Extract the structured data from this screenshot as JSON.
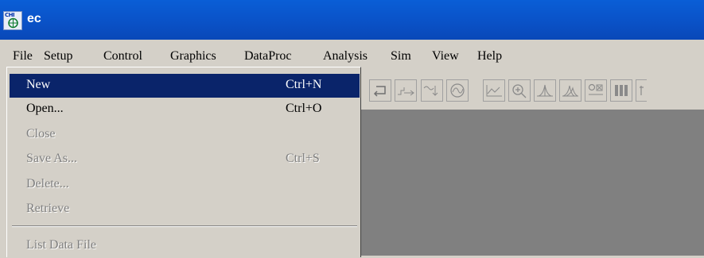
{
  "window": {
    "title": "ec",
    "icon_text": "CHI"
  },
  "menubar": [
    "File",
    "Setup",
    "Control",
    "Graphics",
    "DataProc",
    "Analysis",
    "Sim",
    "View",
    "Help"
  ],
  "file_menu": {
    "items": [
      {
        "label": "New",
        "shortcut": "Ctrl+N",
        "state": "selected"
      },
      {
        "label": "Open...",
        "shortcut": "Ctrl+O",
        "state": "enabled"
      },
      {
        "label": "Close",
        "shortcut": "",
        "state": "disabled"
      },
      {
        "label": "Save As...",
        "shortcut": "Ctrl+S",
        "state": "disabled"
      },
      {
        "label": "Delete...",
        "shortcut": "",
        "state": "disabled"
      },
      {
        "label": "Retrieve",
        "shortcut": "",
        "state": "disabled"
      },
      {
        "label": "List Data File",
        "shortcut": "",
        "state": "disabled"
      }
    ]
  },
  "toolbar": {
    "icons": [
      "return-icon",
      "step-icon",
      "filter-icon",
      "sim-icon",
      "graph-icon",
      "zoom-icon",
      "peak-icon",
      "overlay-icon",
      "param-icon",
      "bars-icon"
    ]
  },
  "colors": {
    "titlebar": "#0a53c9",
    "menu_highlight": "#0a246a",
    "face": "#d4d0c8",
    "workarea": "#808080"
  }
}
